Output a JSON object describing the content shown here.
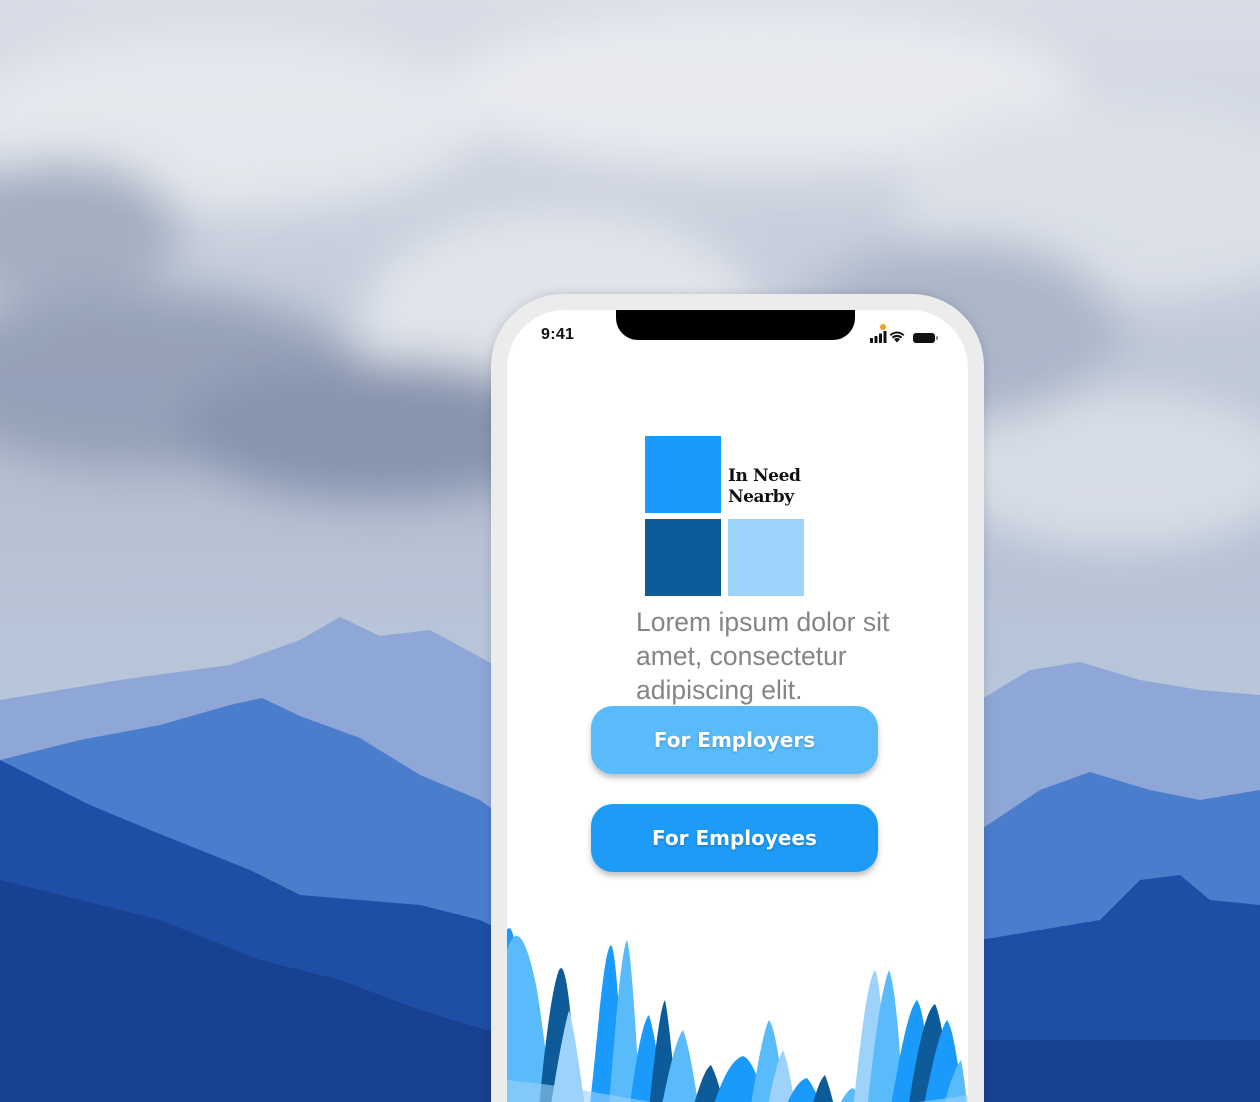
{
  "status_bar": {
    "time": "9:41",
    "icons": [
      "signal-icon",
      "wifi-icon",
      "battery-icon"
    ]
  },
  "logo": {
    "line1": "In Need",
    "line2": "Nearby",
    "colors": [
      "#1a9afa",
      "#0d5c99",
      "#9dd2fb"
    ]
  },
  "tagline": "Lorem ipsum dolor sit amet, consectetur adipiscing elit.",
  "buttons": {
    "employers_label": "For Employers",
    "employees_label": "For Employees"
  },
  "colors": {
    "employers_button": "#59bbfa",
    "employees_button": "#1e9bf7",
    "accent_dark": "#0d5c99",
    "accent_light": "#9dd2fb"
  }
}
